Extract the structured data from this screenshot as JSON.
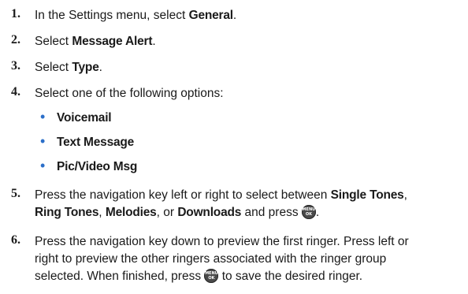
{
  "steps": [
    {
      "num": "1.",
      "t1": "In the Settings menu, select ",
      "b1": "General",
      "t2": "."
    },
    {
      "num": "2.",
      "t1": "Select ",
      "b1": "Message Alert",
      "t2": "."
    },
    {
      "num": "3.",
      "t1": "Select ",
      "b1": "Type",
      "t2": "."
    },
    {
      "num": "4.",
      "t1": "Select one of the following options:"
    },
    {
      "num": "5.",
      "l1a": "Press the navigation key left or right to select between ",
      "l1b": "Single Tones",
      "l1c": ",",
      "l2a": "Ring Tones",
      "l2b": ", ",
      "l2c": "Melodies",
      "l2d": ", or ",
      "l2e": "Downloads",
      "l2f": " and press ",
      "l2g": "."
    },
    {
      "num": "6.",
      "l1": "Press the navigation key down to preview the first ringer. Press left or",
      "l2": "right to preview the other ringers associated with the ringer group",
      "l3a": "selected. When finished, press ",
      "l3b": " to save the desired ringer."
    }
  ],
  "options": [
    "Voicemail",
    "Text Message",
    "Pic/Video Msg"
  ],
  "bullet_char": "•",
  "key": {
    "icon": "menu-ok-key-icon",
    "line1": "MENU",
    "line2": "OK"
  },
  "colors": {
    "bullet": "#2b6fc9",
    "text": "#1a1a1a",
    "key": "#4a4a4a"
  }
}
